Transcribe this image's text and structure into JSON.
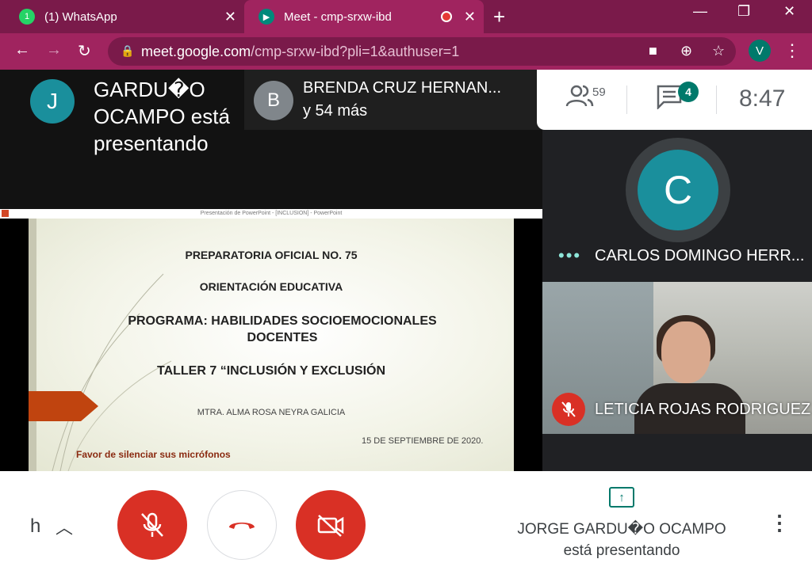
{
  "browser": {
    "tabs": [
      {
        "title": "(1) WhatsApp",
        "close": "✕",
        "badge": "1"
      },
      {
        "title": "Meet - cmp-srxw-ibd",
        "close": "✕"
      }
    ],
    "new_tab": "+",
    "window_controls": {
      "minimize": "—",
      "maximize": "❐",
      "close": "✕"
    },
    "url_host": "meet.google.com",
    "url_path": "/cmp-srxw-ibd?pli=1&authuser=1",
    "profile_initial": "V",
    "accent_color": "#a0245f"
  },
  "meet": {
    "presenter_banner": {
      "avatar_initial": "J",
      "text": "GARDU�O OCAMPO está presentando"
    },
    "others": {
      "avatar_initial": "B",
      "name": "BRENDA CRUZ HERNAN...",
      "more": "y 54 más"
    },
    "toolbar": {
      "people_count": "59",
      "chat_badge": "4",
      "clock": "8:47"
    },
    "shared_screen": {
      "window_title": "Presentación de PowerPoint - [INCLUSION] - PowerPoint",
      "slide_lines": [
        "PREPARATORIA OFICIAL NO. 75",
        "ORIENTACIÓN EDUCATIVA",
        "PROGRAMA: HABILIDADES SOCIOEMOCIONALES DOCENTES",
        "TALLER 7 “INCLUSIÓN Y EXCLUSIÓN",
        "MTRA. ALMA ROSA NEYRA GALICIA",
        "15 DE SEPTIEMBRE DE 2020.",
        "Favor de silenciar sus micrófonos"
      ]
    },
    "tiles": [
      {
        "avatar_initial": "C",
        "name": "CARLOS DOMINGO HERR..."
      },
      {
        "name": "LETICIA ROJAS RODRIGUEZ",
        "muted": true
      }
    ]
  },
  "bottom": {
    "caption_text": "h",
    "presenting_name": "JORGE GARDU�O OCAMPO",
    "presenting_status": "está presentando"
  },
  "colors": {
    "danger": "#d93025",
    "teal": "#00796b",
    "avatar_teal": "#1a8f9c"
  }
}
